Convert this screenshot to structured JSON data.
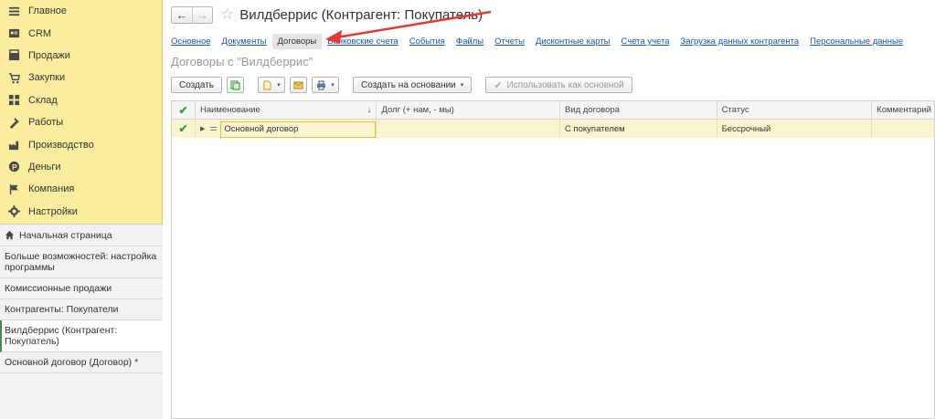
{
  "sidebar": {
    "sections": [
      {
        "label": "Главное",
        "icon": "menu-icon"
      },
      {
        "label": "CRM",
        "icon": "crm-icon"
      },
      {
        "label": "Продажи",
        "icon": "sales-icon"
      },
      {
        "label": "Закупки",
        "icon": "purchases-icon"
      },
      {
        "label": "Склад",
        "icon": "warehouse-icon"
      },
      {
        "label": "Работы",
        "icon": "tools-icon"
      },
      {
        "label": "Производство",
        "icon": "factory-icon"
      },
      {
        "label": "Деньги",
        "icon": "money-icon"
      },
      {
        "label": "Компания",
        "icon": "flag-icon"
      },
      {
        "label": "Настройки",
        "icon": "gear-icon"
      }
    ],
    "open_windows": [
      {
        "label": "Начальная страница",
        "home": true
      },
      {
        "label": "Больше возможностей: настройка программы"
      },
      {
        "label": "Комиссионные продажи"
      },
      {
        "label": "Контрагенты: Покупатели"
      },
      {
        "label": "Вилдберрис (Контрагент: Покупатель)",
        "active": true
      },
      {
        "label": "Основной договор (Договор) *"
      }
    ]
  },
  "header": {
    "back": "←",
    "forward": "→",
    "star": "☆",
    "title": "Вилдберрис (Контрагент: Покупатель)"
  },
  "tabs": [
    {
      "label": "Основное"
    },
    {
      "label": "Документы"
    },
    {
      "label": "Договоры",
      "active": true
    },
    {
      "label": "Банковские счета"
    },
    {
      "label": "События"
    },
    {
      "label": "Файлы"
    },
    {
      "label": "Отчеты"
    },
    {
      "label": "Дисконтные карты"
    },
    {
      "label": "Счета учета"
    },
    {
      "label": "Загрузка данных контрагента"
    },
    {
      "label": "Персональные данные"
    }
  ],
  "subtitle": "Договоры с \"Вилдберрис\"",
  "toolbar": {
    "create": "Создать",
    "create_based": "Создать на основании",
    "use_main": "Использовать как основной",
    "caret": "▾"
  },
  "table": {
    "columns": [
      "",
      "Наименование",
      "Долг (+ нам, - мы)",
      "Вид договора",
      "Статус",
      "Комментарий"
    ],
    "sort_indicator": "↓",
    "rows": [
      {
        "check": "✔",
        "name": "Основной договор",
        "debt": "",
        "kind": "С покупателем",
        "status": "Бессрочный",
        "comment": ""
      }
    ]
  },
  "colors": {
    "sidebar": "#fbed9e",
    "accent_link": "#1b58a7",
    "annotation_arrow": "#e53935",
    "row_highlight": "#fbf5cf"
  }
}
